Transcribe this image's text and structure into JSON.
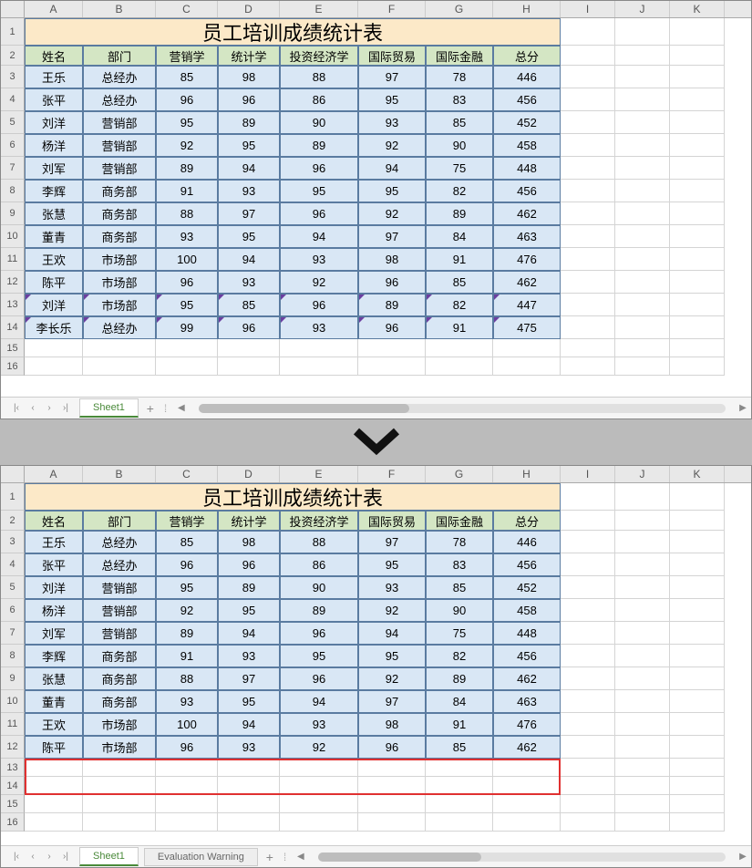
{
  "columns": [
    "A",
    "B",
    "C",
    "D",
    "E",
    "F",
    "G",
    "H",
    "I",
    "J",
    "K"
  ],
  "table_title": "员工培训成绩统计表",
  "headers": [
    "姓名",
    "部门",
    "营销学",
    "统计学",
    "投资经济学",
    "国际贸易",
    "国际金融",
    "总分"
  ],
  "rows_top": [
    {
      "n": "3",
      "name": "王乐",
      "dept": "总经办",
      "v": [
        "85",
        "98",
        "88",
        "97",
        "78",
        "446"
      ]
    },
    {
      "n": "4",
      "name": "张平",
      "dept": "总经办",
      "v": [
        "96",
        "96",
        "86",
        "95",
        "83",
        "456"
      ]
    },
    {
      "n": "5",
      "name": "刘洋",
      "dept": "营销部",
      "v": [
        "95",
        "89",
        "90",
        "93",
        "85",
        "452"
      ]
    },
    {
      "n": "6",
      "name": "杨洋",
      "dept": "营销部",
      "v": [
        "92",
        "95",
        "89",
        "92",
        "90",
        "458"
      ]
    },
    {
      "n": "7",
      "name": "刘军",
      "dept": "营销部",
      "v": [
        "89",
        "94",
        "96",
        "94",
        "75",
        "448"
      ]
    },
    {
      "n": "8",
      "name": "李辉",
      "dept": "商务部",
      "v": [
        "91",
        "93",
        "95",
        "95",
        "82",
        "456"
      ]
    },
    {
      "n": "9",
      "name": "张慧",
      "dept": "商务部",
      "v": [
        "88",
        "97",
        "96",
        "92",
        "89",
        "462"
      ]
    },
    {
      "n": "10",
      "name": "董青",
      "dept": "商务部",
      "v": [
        "93",
        "95",
        "94",
        "97",
        "84",
        "463"
      ]
    },
    {
      "n": "11",
      "name": "王欢",
      "dept": "市场部",
      "v": [
        "100",
        "94",
        "93",
        "98",
        "91",
        "476"
      ]
    },
    {
      "n": "12",
      "name": "陈平",
      "dept": "市场部",
      "v": [
        "96",
        "93",
        "92",
        "96",
        "85",
        "462"
      ]
    },
    {
      "n": "13",
      "name": "刘洋",
      "dept": "市场部",
      "v": [
        "95",
        "85",
        "96",
        "89",
        "82",
        "447"
      ],
      "highlight": true
    },
    {
      "n": "14",
      "name": "李长乐",
      "dept": "总经办",
      "v": [
        "99",
        "96",
        "93",
        "96",
        "91",
        "475"
      ],
      "highlight": true
    }
  ],
  "empty_rows_top": [
    "15",
    "16"
  ],
  "rows_bottom": [
    {
      "n": "3",
      "name": "王乐",
      "dept": "总经办",
      "v": [
        "85",
        "98",
        "88",
        "97",
        "78",
        "446"
      ]
    },
    {
      "n": "4",
      "name": "张平",
      "dept": "总经办",
      "v": [
        "96",
        "96",
        "86",
        "95",
        "83",
        "456"
      ]
    },
    {
      "n": "5",
      "name": "刘洋",
      "dept": "营销部",
      "v": [
        "95",
        "89",
        "90",
        "93",
        "85",
        "452"
      ]
    },
    {
      "n": "6",
      "name": "杨洋",
      "dept": "营销部",
      "v": [
        "92",
        "95",
        "89",
        "92",
        "90",
        "458"
      ]
    },
    {
      "n": "7",
      "name": "刘军",
      "dept": "营销部",
      "v": [
        "89",
        "94",
        "96",
        "94",
        "75",
        "448"
      ]
    },
    {
      "n": "8",
      "name": "李辉",
      "dept": "商务部",
      "v": [
        "91",
        "93",
        "95",
        "95",
        "82",
        "456"
      ]
    },
    {
      "n": "9",
      "name": "张慧",
      "dept": "商务部",
      "v": [
        "88",
        "97",
        "96",
        "92",
        "89",
        "462"
      ]
    },
    {
      "n": "10",
      "name": "董青",
      "dept": "商务部",
      "v": [
        "93",
        "95",
        "94",
        "97",
        "84",
        "463"
      ]
    },
    {
      "n": "11",
      "name": "王欢",
      "dept": "市场部",
      "v": [
        "100",
        "94",
        "93",
        "98",
        "91",
        "476"
      ]
    },
    {
      "n": "12",
      "name": "陈平",
      "dept": "市场部",
      "v": [
        "96",
        "93",
        "92",
        "96",
        "85",
        "462"
      ]
    }
  ],
  "empty_rows_bottom": [
    "13",
    "14",
    "15",
    "16"
  ],
  "deleted_range_rows": [
    "13",
    "14"
  ],
  "tabs": {
    "sheet1": "Sheet1",
    "add": "+",
    "eval_warning": "Evaluation Warning"
  },
  "nav": {
    "first": "|‹",
    "prev": "‹",
    "next": "›",
    "last": "›|"
  }
}
